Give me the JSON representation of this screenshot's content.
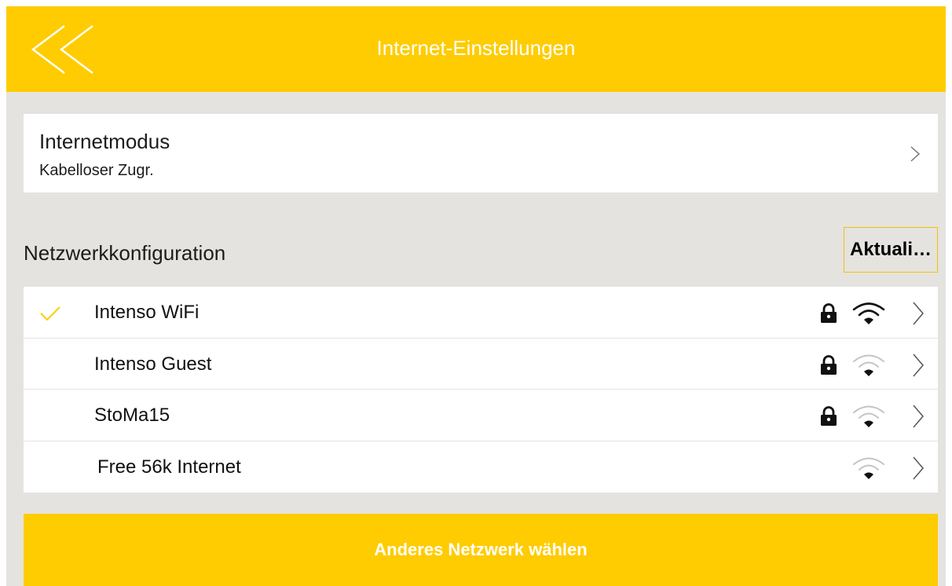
{
  "colors": {
    "accent": "#fecc00",
    "background": "#e5e3df",
    "card": "#ffffff"
  },
  "header": {
    "title": "Internet-Einstellungen",
    "back_icon": "double-chevron-left-icon"
  },
  "internet_mode": {
    "label": "Internetmodus",
    "value": "Kabelloser Zugr."
  },
  "network_config": {
    "title": "Netzwerkkonfiguration",
    "refresh_label": "Aktuali…"
  },
  "networks": [
    {
      "name": "Intenso WiFi",
      "connected": true,
      "secured": true,
      "signal": "strong"
    },
    {
      "name": "Intenso Guest",
      "connected": false,
      "secured": true,
      "signal": "weak"
    },
    {
      "name": "StoMa15",
      "connected": false,
      "secured": true,
      "signal": "weak"
    },
    {
      "name": "Free 56k Internet",
      "connected": false,
      "secured": false,
      "signal": "weak"
    }
  ],
  "other_network": {
    "label": "Anderes Netzwerk wählen"
  }
}
